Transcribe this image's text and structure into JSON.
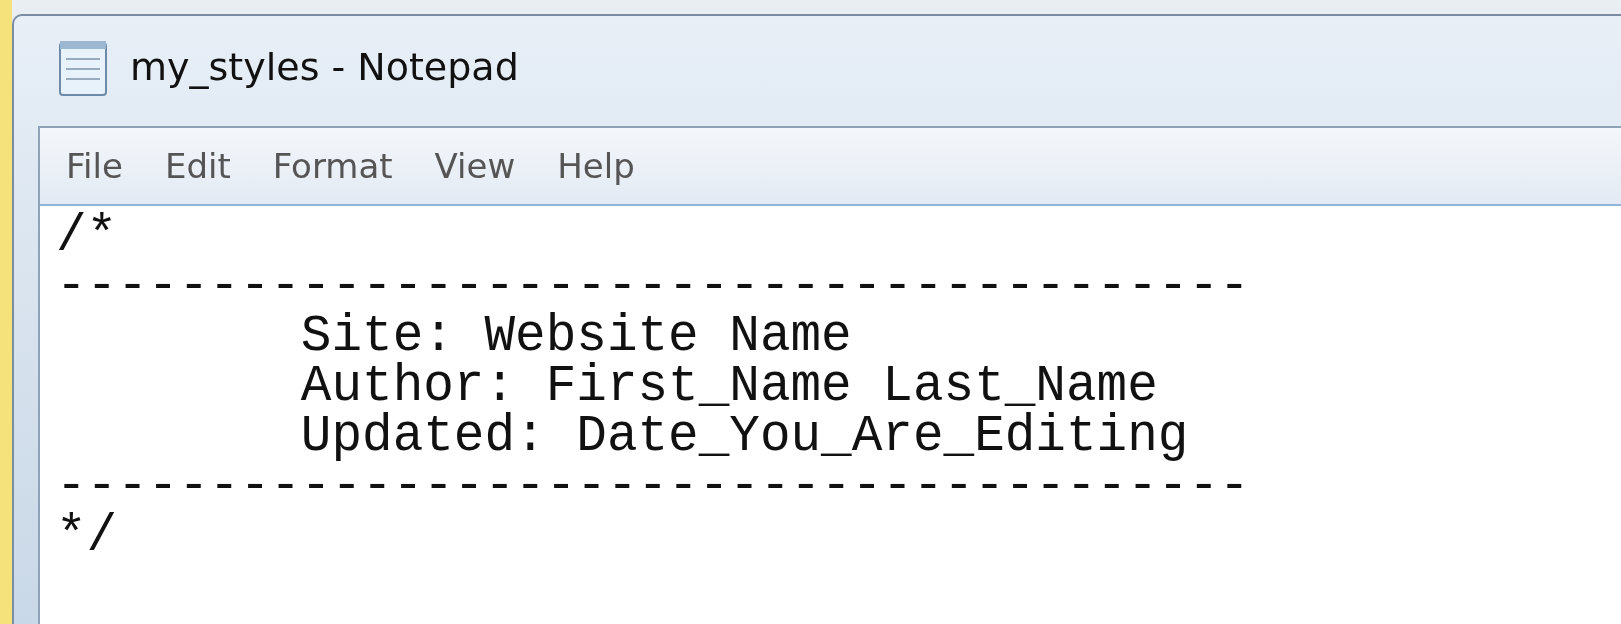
{
  "window": {
    "title": "my_styles - Notepad"
  },
  "menu": [
    "File",
    "Edit",
    "Format",
    "View",
    "Help"
  ],
  "editor": {
    "lines": [
      "/*",
      "---------------------------------------",
      "        Site: Website Name",
      "        Author: First_Name Last_Name",
      "        Updated: Date_You_Are_Editing",
      "---------------------------------------",
      "*/"
    ]
  }
}
